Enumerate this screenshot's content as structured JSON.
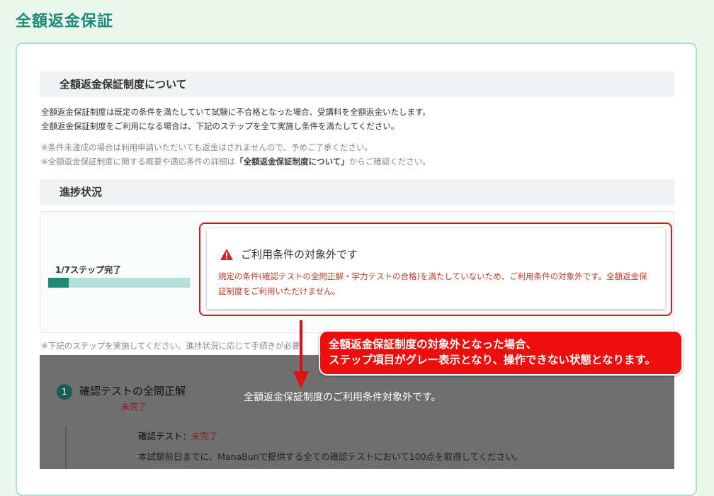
{
  "page": {
    "title": "全額返金保証"
  },
  "about": {
    "heading": "全額返金保証制度について",
    "para1": "全額返金保証制度は既定の条件を満たしていて試験に不合格となった場合、受講料を全額返金いたします。",
    "para2": "全額返金保証制度をご利用になる場合は、下記のステップを全て実施し条件を満たしてください。",
    "note1": "※条件未達成の場合は利用申請いただいても返金はされませんので、予めご了承ください。",
    "note2_prefix": "※全額返金保証制度に関する概要や適応条件の詳細は",
    "note2_link": "「全額返金保証制度について」",
    "note2_suffix": "からご確認ください。"
  },
  "progress": {
    "heading": "進捗状況",
    "steps_label": "1/7ステップ完了",
    "completed": 1,
    "total": 7
  },
  "alert": {
    "title": "ご利用条件の対象外です",
    "message": "規定の条件(確認テストの全問正解・学力テストの合格)を満たしていないため、ご利用条件の対象外です。全額返金保証制度をご利用いただけません。",
    "icon": "warning-icon"
  },
  "under_note": "※下記のステップを実施してください。進捗状況に応じて手続きが必要",
  "step": {
    "number": "1",
    "title": "確認テストの全問正解",
    "status": "未完了",
    "sub_label": "確認テスト：",
    "sub_status": "未完了",
    "sub_desc": "本試験前日までに、ManaBunで提供する全ての確認テストにおいて100点を取得してください。"
  },
  "overlay_message": "全額返金保証制度のご利用条件対象外です。",
  "callout": {
    "line1": "全額返金保証制度の対象外となった場合、",
    "line2": "ステップ項目がグレー表示となり、操作できない状態となります。"
  },
  "colors": {
    "brand": "#1f8a78",
    "alert_red": "#e0151e",
    "callout_red": "#ee0e0e",
    "overlay_gray": "#6f6f6f"
  }
}
